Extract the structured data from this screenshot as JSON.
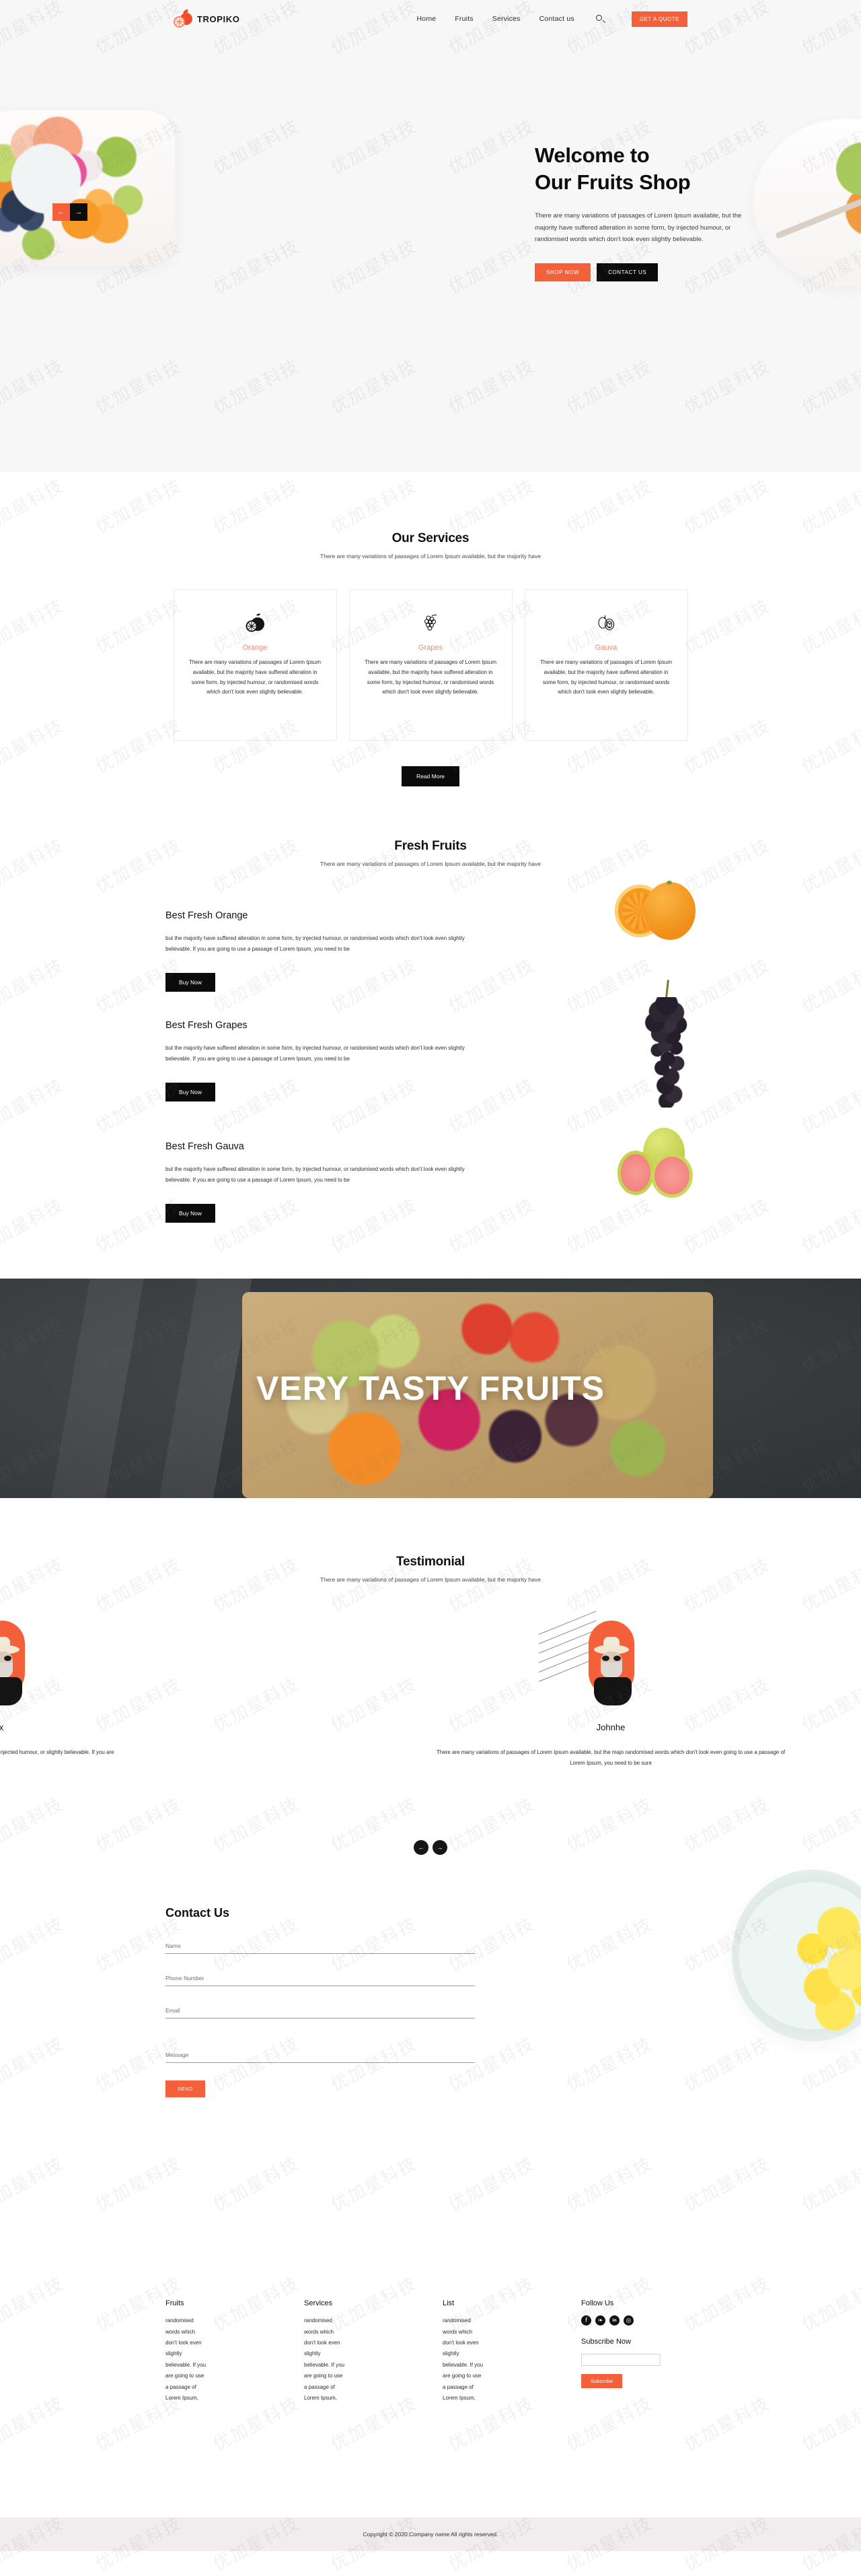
{
  "header": {
    "brand": "TROPIKO",
    "nav": [
      {
        "label": "Home"
      },
      {
        "label": "Fruits"
      },
      {
        "label": "Services"
      },
      {
        "label": "Contact us"
      }
    ],
    "search_icon": "search-icon",
    "quote_button": "GET A QUOTE"
  },
  "hero": {
    "title_line1": "Welcome to",
    "title_line2": "Our Fruits Shop",
    "paragraph": "There are many variations of passages of Lorem Ipsum available, but the majority have suffered alteration in some form, by injected humour, or randomised words which don't look even slightly believable.",
    "primary_button": "SHOP NOW",
    "secondary_button": "CONTACT US",
    "carousel_prev": "←",
    "carousel_next": "→"
  },
  "services": {
    "title": "Our Services",
    "subtitle": "There are many variations of passages of Lorem Ipsum available, but the majority have",
    "cards": [
      {
        "icon": "orange-fruit-icon",
        "title": "Orange",
        "text": "There are many variations of passages of Lorem Ipsum available, but the majority have suffered alteration in some form, by injected humour, or randomised words which don't look even slightly believable."
      },
      {
        "icon": "grapes-fruit-icon",
        "title": "Grapes",
        "text": "There are many variations of passages of Lorem Ipsum available, but the majority have suffered alteration in some form, by injected humour, or randomised words which don't look even slightly believable."
      },
      {
        "icon": "guava-fruit-icon",
        "title": "Gauva",
        "text": "There are many variations of passages of Lorem Ipsum available, but the majority have suffered alteration in some form, by injected humour, or randomised words which don't look even slightly believable."
      }
    ],
    "read_more": "Read More"
  },
  "fresh": {
    "title": "Fresh Fruits",
    "subtitle": "There are many variations of passages of Lorem Ipsum available, but the majority have",
    "items": [
      {
        "name": "Best Fresh Orange",
        "text": "but the majority have suffered alteration in some form, by injected humour, or randomised words which don't look even slightly believable. If you are going to use a passage of Lorem Ipsum, you need to be",
        "button": "Buy Now"
      },
      {
        "name": "Best Fresh Grapes",
        "text": "but the majority have suffered alteration in some form, by injected humour, or randomised words which don't look even slightly believable. If you are going to use a passage of Lorem Ipsum, you need to be",
        "button": "Buy Now"
      },
      {
        "name": "Best Fresh Gauva",
        "text": "but the majority have suffered alteration in some form, by injected humour, or randomised words which don't look even slightly believable. If you are going to use a passage of Lorem Ipsum, you need to be",
        "button": "Buy Now"
      }
    ]
  },
  "banner": {
    "title": "VERY TASTY FRUITS"
  },
  "testimonial": {
    "title": "Testimonial",
    "subtitle": "There are many variations of passages of Lorem Ipsum available, but the majority have",
    "slides": [
      {
        "name": "x",
        "text": "ority have suffered alteration in some form, by injected humour, or slightly believable. If you are"
      },
      {
        "name": "Johnhe",
        "text": "There are many variations of passages of Lorem Ipsum available, but the majo randomised words which don't look even going to use a passage of Lorem Ipsum, you need to be sure"
      }
    ],
    "prev": "←",
    "next": "→"
  },
  "contact": {
    "title": "Contact Us",
    "fields": [
      {
        "name": "name",
        "placeholder": "Name",
        "value": ""
      },
      {
        "name": "phone",
        "placeholder": "Phone Number",
        "value": ""
      },
      {
        "name": "email",
        "placeholder": "Email",
        "value": ""
      },
      {
        "name": "message",
        "placeholder": "Message",
        "value": ""
      }
    ],
    "send_button": "SEND"
  },
  "footer": {
    "columns": [
      {
        "title": "Fruits",
        "text": "randomised words which don't look even slightly believable. If you are going to use a passage of Lorem Ipsum,"
      },
      {
        "title": "Services",
        "text": "randomised words which don't look even slightly believable. If you are going to use a passage of Lorem Ipsum,"
      },
      {
        "title": "List",
        "text": "randomised words which don't look even slightly believable. If you are going to use a passage of Lorem Ipsum,"
      }
    ],
    "follow_title": "Follow Us",
    "socials": [
      {
        "icon": "facebook-icon",
        "glyph": "f"
      },
      {
        "icon": "twitter-icon",
        "glyph": "❧"
      },
      {
        "icon": "linkedin-icon",
        "glyph": "in"
      },
      {
        "icon": "instagram-icon",
        "glyph": "◎"
      }
    ],
    "subscribe_title": "Subscribe Now",
    "subscribe_value": "",
    "subscribe_placeholder": "",
    "subscribe_button": "Subscribe",
    "copyright": "Copyright © 2020.Company name All rights reserved."
  },
  "colors": {
    "accent": "#f4603a",
    "dark": "#0b0b0b",
    "muted_bg": "#f7f7f7",
    "card_title": "#f08a6b"
  },
  "watermark": "优加星科技"
}
